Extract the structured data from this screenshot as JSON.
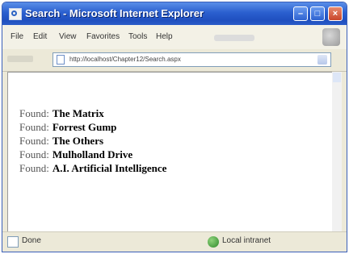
{
  "window": {
    "title": "Search - Microsoft Internet Explorer",
    "controls": {
      "minimize": "–",
      "maximize": "□",
      "close": "×"
    }
  },
  "menubar": {
    "items": [
      "File",
      "Edit",
      "View",
      "Favorites",
      "Tools",
      "Help"
    ]
  },
  "address": {
    "url": "http://localhost/Chapter12/Search.aspx"
  },
  "results": {
    "label": "Found:",
    "items": [
      "The Matrix",
      "Forrest Gump",
      "The Others",
      "Mulholland Drive",
      "A.I. Artificial Intelligence"
    ]
  },
  "status": {
    "text": "Done",
    "zone": "Local intranet"
  },
  "colors": {
    "title_bar": "#2a5fcf",
    "chrome": "#ece9d8"
  }
}
